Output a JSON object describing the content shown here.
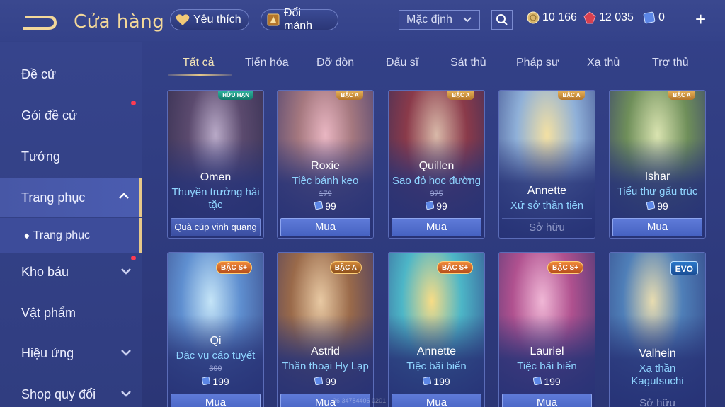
{
  "header": {
    "title": "Cửa hàng",
    "favorites_label": "Yêu thích",
    "shard_label": "Đổi mảnh",
    "sort_value": "Mặc định",
    "gold": "10 166",
    "ruby": "12 035",
    "voucher": "0",
    "plus": "+"
  },
  "sidebar": {
    "items": [
      {
        "label": "Đề cử"
      },
      {
        "label": "Gói đề cử"
      },
      {
        "label": "Tướng"
      },
      {
        "label": "Trang phục"
      },
      {
        "label": "Trang phục"
      },
      {
        "label": "Kho báu"
      },
      {
        "label": "Vật phẩm"
      },
      {
        "label": "Hiệu ứng"
      },
      {
        "label": "Shop quy đổi"
      }
    ]
  },
  "tabs": [
    {
      "label": "Tất cả"
    },
    {
      "label": "Tiến hóa"
    },
    {
      "label": "Đỡ đòn"
    },
    {
      "label": "Đấu sĩ"
    },
    {
      "label": "Sát thủ"
    },
    {
      "label": "Pháp sư"
    },
    {
      "label": "Xạ thủ"
    },
    {
      "label": "Trợ thủ"
    }
  ],
  "cards": [
    {
      "hero": "Omen",
      "skin_line1": "Thuyền trưởng hải",
      "skin_line2": "tặc",
      "badge": "HỮU HẠN",
      "action": "Quà cúp vinh quang"
    },
    {
      "hero": "Roxie",
      "skin": "Tiệc bánh kẹo",
      "badge": "BẬC A",
      "old_price": "179",
      "price": "99",
      "action": "Mua"
    },
    {
      "hero": "Quillen",
      "skin": "Sao đỏ học đường",
      "badge": "BẬC A",
      "old_price": "375",
      "price": "99",
      "action": "Mua"
    },
    {
      "hero": "Annette",
      "skin": "Xứ sở thần tiên",
      "badge": "BẬC A",
      "action": "Sở hữu"
    },
    {
      "hero": "Ishar",
      "skin": "Tiểu thư gấu trúc",
      "badge": "BẬC A",
      "price": "99",
      "action": "Mua"
    },
    {
      "hero": "Qi",
      "skin": "Đặc vụ cáo tuyết",
      "badge": "BẬC S+",
      "old_price": "399",
      "price": "199",
      "action": "Mua"
    },
    {
      "hero": "Astrid",
      "skin": "Thần thoại Hy Lạp",
      "badge": "BẬC A",
      "price": "99",
      "action": "Mua"
    },
    {
      "hero": "Annette",
      "skin": "Tiệc bãi biển",
      "badge": "BẬC S+",
      "price": "199",
      "action": "Mua"
    },
    {
      "hero": "Lauriel",
      "skin": "Tiệc bãi biển",
      "badge": "BẬC S+",
      "price": "199",
      "action": "Mua"
    },
    {
      "hero": "Valhein",
      "skin_line1": "Xạ thần",
      "skin_line2": "Kagutsuchi",
      "badge": "EVO",
      "action": "Sở hữu"
    }
  ],
  "watermark": "36 34784406 0201",
  "colors": {
    "accent_gold": "#e7c989",
    "skin_name_blue": "#8fd4ff",
    "buy_button": "#5f7bd8",
    "notification_red": "#ff3b52"
  }
}
